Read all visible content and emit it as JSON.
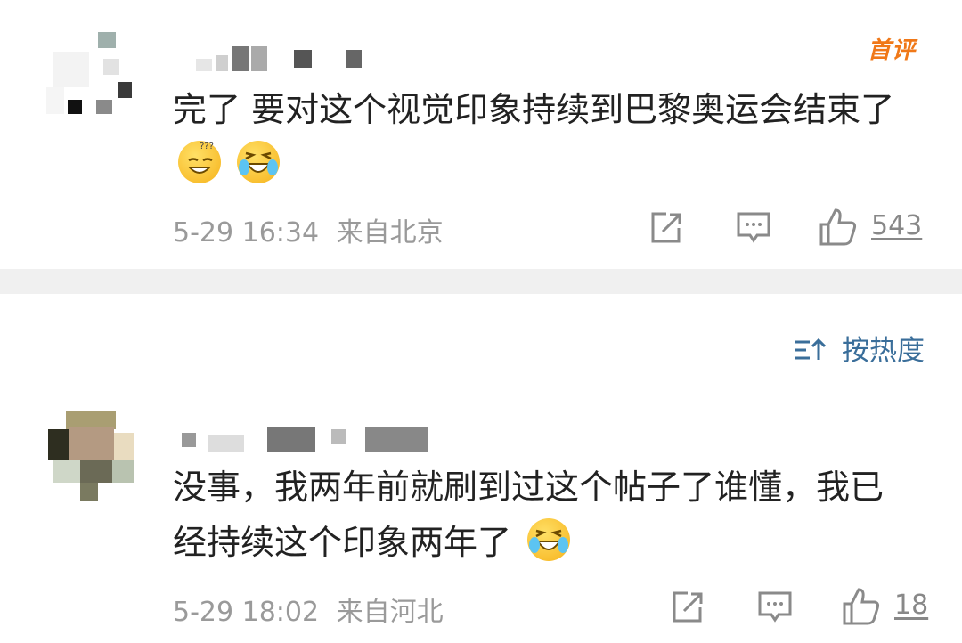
{
  "comments": [
    {
      "badge": "首评",
      "text": "完了 要对这个视觉印象持续到巴黎奥运会结束了",
      "emojis": [
        "dizzy-grin-icon",
        "laugh-cry-icon"
      ],
      "time": "5-29 16:34",
      "location": "来自北京",
      "likes": "543"
    },
    {
      "text": "没事，我两年前就刷到过这个帖子了谁懂，我已经持续这个印象两年了",
      "emojis": [
        "laugh-cry-icon"
      ],
      "time": "5-29 18:02",
      "location": "来自河北",
      "likes": "18"
    }
  ],
  "sort": {
    "label": "按热度"
  },
  "colors": {
    "badge": "#f07818",
    "sort": "#3a6e9a",
    "meta": "#9a9a9a",
    "divider": "#f0f0f0"
  }
}
